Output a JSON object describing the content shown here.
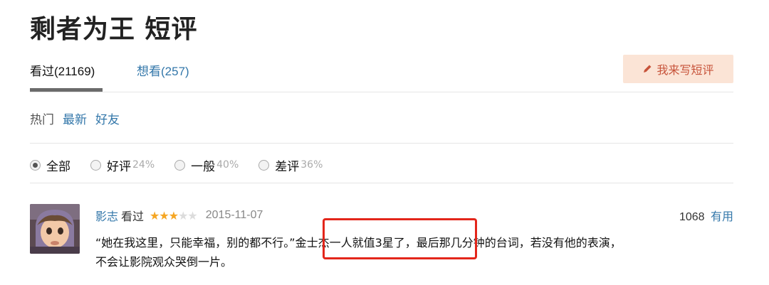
{
  "page": {
    "title": "剩者为王 短评"
  },
  "tabs": [
    {
      "label": "看过(21169)"
    },
    {
      "label": "想看(257)"
    }
  ],
  "write_button": {
    "label": "我来写短评",
    "icon": "pencil-icon"
  },
  "sort": {
    "hot": "热门",
    "latest": "最新",
    "friends": "好友"
  },
  "filters": [
    {
      "label": "全部",
      "percent": "",
      "checked": true
    },
    {
      "label": "好评",
      "percent": "24%",
      "checked": false
    },
    {
      "label": "一般",
      "percent": "40%",
      "checked": false
    },
    {
      "label": "差评",
      "percent": "36%",
      "checked": false
    }
  ],
  "comment": {
    "user": "影志",
    "status": "看过",
    "rating": 3,
    "rating_max": 5,
    "date": "2015-11-07",
    "votes": "1068",
    "useful_label": "有用",
    "text_line1": "“她在我这里，只能幸福，别的都不行。”金士杰一人就值3星了，最后那几分钟的台词，若没有他的表演，",
    "text_line2": "不会让影院观众哭倒一片。"
  },
  "colors": {
    "link": "#3377aa",
    "star": "#f5a623",
    "highlight": "#e3261b",
    "button_bg": "#fbe4d6"
  }
}
